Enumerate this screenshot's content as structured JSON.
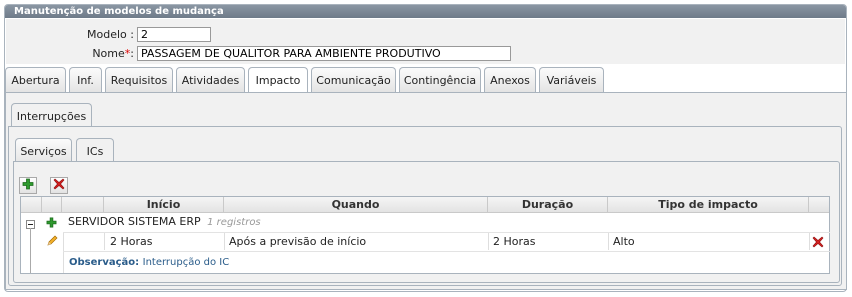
{
  "panel": {
    "title": "Manutenção de modelos de mudança"
  },
  "form": {
    "modelo_label": "Modelo :",
    "modelo_value": "2",
    "nome_label": "Nome",
    "nome_required": "*",
    "nome_colon": ":",
    "nome_value": "PASSAGEM DE QUALITOR PARA AMBIENTE PRODUTIVO"
  },
  "tabs": [
    {
      "label": "Abertura"
    },
    {
      "label": "Inf."
    },
    {
      "label": "Requisitos"
    },
    {
      "label": "Atividades"
    },
    {
      "label": "Impacto"
    },
    {
      "label": "Comunicação"
    },
    {
      "label": "Contingência"
    },
    {
      "label": "Anexos"
    },
    {
      "label": "Variáveis"
    }
  ],
  "active_tab": "Impacto",
  "subtab_interrupcoes": "Interrupções",
  "inner_tabs": [
    {
      "label": "Serviços"
    },
    {
      "label": "ICs"
    }
  ],
  "active_inner_tab": "ICs",
  "grid": {
    "columns": [
      "Início",
      "Quando",
      "Duração",
      "Tipo de impacto"
    ],
    "group": {
      "name": "SERVIDOR SISTEMA ERP",
      "count": "1 registros"
    },
    "row": {
      "inicio": "2 Horas",
      "quando": "Após a previsão de início",
      "duracao": "2 Horas",
      "tipo": "Alto"
    },
    "observacao_label": "Observação:",
    "observacao_value": "Interrupção do IC"
  },
  "colors": {
    "title_bar": "#7b8795",
    "accent_link": "#2a5c8a",
    "add_green": "#2e9a2e",
    "delete_red": "#d42020"
  },
  "icons": [
    "add-icon",
    "delete-icon",
    "collapse-icon",
    "expand-icon",
    "edit-pencil-icon",
    "row-delete-icon"
  ]
}
